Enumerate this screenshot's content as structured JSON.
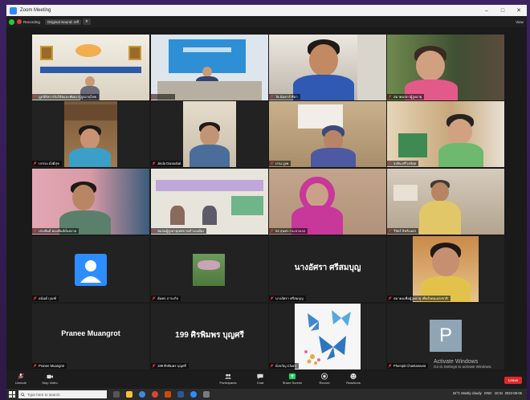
{
  "window": {
    "title": "Zoom Meeting",
    "controls": [
      "–",
      "□",
      "✕"
    ]
  },
  "topbar": {
    "recording_label": "Recording",
    "sound_option": "Original Sound: Off",
    "view_label": "View"
  },
  "participants": [
    {
      "name": "มูลนิธิสถาบันวิจัยและพัฒนาผู้สูงอายุไทย",
      "kind": "video",
      "active": true
    },
    {
      "name": "",
      "kind": "video"
    },
    {
      "name": "Ta นัดตาล้ ศิลา",
      "kind": "video"
    },
    {
      "name": "สมาคมสภาผู้สูงอายุ",
      "kind": "video"
    },
    {
      "name": "บรรจง มั่งมีสุข",
      "kind": "video"
    },
    {
      "name": "Jinda Danoubal",
      "kind": "video"
    },
    {
      "name": "ปาน ภูเพ",
      "kind": "video"
    },
    {
      "name": "จงจิน ศรีวงษ์สุด",
      "kind": "video"
    },
    {
      "name": "ประพันธ์ ทองพันธ์มั่นสงวน",
      "kind": "video"
    },
    {
      "name": "ชมรมผู้สูงอายุเทศบาลตำบลเมือง",
      "kind": "video"
    },
    {
      "name": "04 สุนทร กระจางเรง",
      "kind": "video"
    },
    {
      "name": "วิจิตร์ สิทธิเนตร",
      "kind": "video"
    },
    {
      "name": "อนันต์ กุณฑ์",
      "kind": "avatar"
    },
    {
      "name": "อัมพร ภาระกิจ",
      "kind": "photo"
    },
    {
      "name": "นางอัศรา ศรีสมบุญ",
      "kind": "text",
      "big": "นางอัศรา ศรีสมบุญ"
    },
    {
      "name": "สมาคมเพื่อผู้สูงอายุ เพื่อสังคมแห่งชาติ",
      "kind": "photo"
    },
    {
      "name": "Pranee Muangrot",
      "kind": "text",
      "big": "Pranee Muangrot"
    },
    {
      "name": "199 ศิรพิมพร บุญศรี",
      "kind": "text",
      "big": "199 ศิรพิมพร บุญศรี"
    },
    {
      "name": "มิ่งขวัญ Charo",
      "kind": "butterfly"
    },
    {
      "name": "Phenipit Chantanavat",
      "kind": "letter",
      "big": "P"
    }
  ],
  "toolbar": {
    "items": [
      {
        "label": "Unmute",
        "icon": "microphone-muted-icon"
      },
      {
        "label": "Stop Video",
        "icon": "video-camera-icon"
      },
      {
        "label": "Participants",
        "icon": "participants-icon",
        "count": "20"
      },
      {
        "label": "Chat",
        "icon": "chat-icon"
      },
      {
        "label": "Share Screen",
        "icon": "share-screen-icon"
      },
      {
        "label": "Record",
        "icon": "record-icon"
      },
      {
        "label": "Reactions",
        "icon": "reactions-icon"
      }
    ],
    "leave_label": "Leave",
    "accent_color": "#e02828"
  },
  "watermark": {
    "line1": "Activate Windows",
    "line2": "Go to Settings to activate Windows."
  },
  "taskbar": {
    "search_placeholder": "Type here to search",
    "weather": "34°C  Mostly cloudy",
    "lang": "ENG",
    "time": "10:31",
    "date": "2022-08-05"
  }
}
